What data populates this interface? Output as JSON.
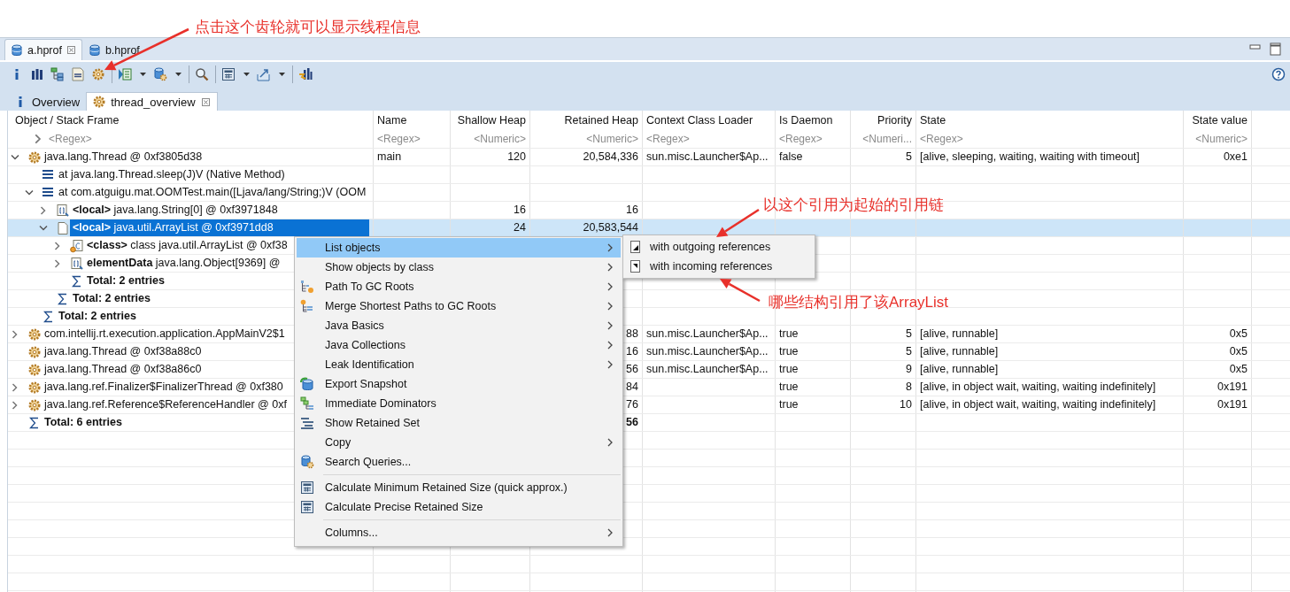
{
  "editor_tabs": [
    {
      "label": "a.hprof",
      "selected": true,
      "closable": true
    },
    {
      "label": "b.hprof",
      "selected": false,
      "closable": false
    }
  ],
  "view_tabs": [
    {
      "label": "Overview",
      "kind": "info",
      "selected": false,
      "closable": false
    },
    {
      "label": "thread_overview",
      "kind": "threads",
      "selected": true,
      "closable": true
    }
  ],
  "table": {
    "columns": [
      {
        "label": "Object / Stack Frame",
        "filter": "<Regex>"
      },
      {
        "label": "Name",
        "filter": "<Regex>"
      },
      {
        "label": "Shallow Heap",
        "filter": "<Numeric>"
      },
      {
        "label": "Retained Heap",
        "filter": "<Numeric>"
      },
      {
        "label": "Context Class Loader",
        "filter": "<Regex>"
      },
      {
        "label": "Is Daemon",
        "filter": "<Regex>"
      },
      {
        "label": "Priority",
        "filter": "<Numeri..."
      },
      {
        "label": "State",
        "filter": "<Regex>"
      },
      {
        "label": "State value",
        "filter": "<Numeric>"
      }
    ],
    "rows": [
      {
        "kind": "thread",
        "text": "java.lang.Thread @ 0xf3805d38",
        "expanded": true,
        "selected": false,
        "name": "main",
        "shallow_heap": "120",
        "retained_heap": "20,584,336",
        "class_loader": "sun.misc.Launcher$Ap...",
        "is_daemon": "false",
        "priority": "5",
        "state": "[alive, sleeping, waiting, waiting with timeout]",
        "state_value": "0xe1",
        "children": [
          {
            "kind": "frame",
            "text": "at java.lang.Thread.sleep(J)V (Native Method)",
            "selected": false
          },
          {
            "kind": "frame",
            "text": "at com.atguigu.mat.OOMTest.main([Ljava/lang/String;)V (OOM",
            "expanded": true,
            "selected": false,
            "children": [
              {
                "kind": "array",
                "text": "**<local>** java.lang.String[0] @ 0xf3971848",
                "expanded": false,
                "selected": false,
                "shallow_heap": "16",
                "retained_heap": "16"
              },
              {
                "kind": "object",
                "text": "**<local>** java.util.ArrayList @ 0xf3971dd8",
                "expanded": true,
                "selected": true,
                "shallow_heap": "24",
                "retained_heap": "20,583,544",
                "children": [
                  {
                    "kind": "class",
                    "text": "**<class>** class java.util.ArrayList @ 0xf38",
                    "expanded": false,
                    "selected": false
                  },
                  {
                    "kind": "array",
                    "text": "**elementData** java.lang.Object[9369] @",
                    "expanded": false,
                    "selected": false
                  },
                  {
                    "kind": "total",
                    "text": "Total: 2 entries",
                    "selected": false
                  }
                ]
              },
              {
                "kind": "total",
                "text": "Total: 2 entries",
                "selected": false
              }
            ]
          },
          {
            "kind": "total",
            "text": "Total: 2 entries",
            "selected": false
          }
        ]
      },
      {
        "kind": "thread",
        "text": "com.intellij.rt.execution.application.AppMainV2$1",
        "expanded": false,
        "selected": false,
        "retained_heap": "88",
        "class_loader": "sun.misc.Launcher$Ap...",
        "is_daemon": "true",
        "priority": "5",
        "state": "[alive, runnable]",
        "state_value": "0x5"
      },
      {
        "kind": "thread",
        "text": "java.lang.Thread @ 0xf38a88c0",
        "selected": false,
        "retained_heap": "16",
        "class_loader": "sun.misc.Launcher$Ap...",
        "is_daemon": "true",
        "priority": "5",
        "state": "[alive, runnable]",
        "state_value": "0x5"
      },
      {
        "kind": "thread",
        "text": "java.lang.Thread @ 0xf38a86c0",
        "selected": false,
        "retained_heap": "56",
        "class_loader": "sun.misc.Launcher$Ap...",
        "is_daemon": "true",
        "priority": "9",
        "state": "[alive, runnable]",
        "state_value": "0x5"
      },
      {
        "kind": "thread",
        "text": "java.lang.ref.Finalizer$FinalizerThread @ 0xf380",
        "expanded": false,
        "selected": false,
        "retained_heap": "84",
        "is_daemon": "true",
        "priority": "8",
        "state": "[alive, in object wait, waiting, waiting indefinitely]",
        "state_value": "0x191"
      },
      {
        "kind": "thread",
        "text": "java.lang.ref.Reference$ReferenceHandler @ 0xf",
        "expanded": false,
        "selected": false,
        "retained_heap": "76",
        "is_daemon": "true",
        "priority": "10",
        "state": "[alive, in object wait, waiting, waiting indefinitely]",
        "state_value": "0x191"
      },
      {
        "kind": "total",
        "text": "Total: 6 entries",
        "selected": false,
        "retained_heap": "56"
      }
    ]
  },
  "context_menu": {
    "items": [
      {
        "kind": "item",
        "label": "List objects",
        "submenu": true,
        "selected": true
      },
      {
        "kind": "item",
        "label": "Show objects by class",
        "submenu": true,
        "selected": false
      },
      {
        "kind": "item",
        "label": "Path To GC Roots",
        "submenu": true,
        "selected": false
      },
      {
        "kind": "item",
        "label": "Merge Shortest Paths to GC Roots",
        "submenu": true,
        "selected": false
      },
      {
        "kind": "item",
        "label": "Java Basics",
        "submenu": true,
        "selected": false
      },
      {
        "kind": "item",
        "label": "Java Collections",
        "submenu": true,
        "selected": false
      },
      {
        "kind": "item",
        "label": "Leak Identification",
        "submenu": true,
        "selected": false
      },
      {
        "kind": "item",
        "label": "Export Snapshot",
        "submenu": false,
        "selected": false
      },
      {
        "kind": "item",
        "label": "Immediate Dominators",
        "submenu": false,
        "selected": false
      },
      {
        "kind": "item",
        "label": "Show Retained Set",
        "submenu": false,
        "selected": false
      },
      {
        "kind": "item",
        "label": "Copy",
        "submenu": true,
        "selected": false
      },
      {
        "kind": "item",
        "label": "Search Queries...",
        "submenu": false,
        "selected": false
      },
      {
        "kind": "separator"
      },
      {
        "kind": "item",
        "label": "Calculate Minimum Retained Size (quick approx.)",
        "submenu": false,
        "selected": false
      },
      {
        "kind": "item",
        "label": "Calculate Precise Retained Size",
        "submenu": false,
        "selected": false
      },
      {
        "kind": "separator"
      },
      {
        "kind": "item",
        "label": "Columns...",
        "submenu": true,
        "selected": false
      }
    ],
    "submenu": [
      {
        "label": "with outgoing references",
        "kind": "outgoing",
        "selected": false
      },
      {
        "label": "with incoming references",
        "kind": "incoming",
        "selected": false
      }
    ]
  },
  "annotations": [
    {
      "text": "点击这个齿轮就可以显示线程信息"
    },
    {
      "text": "以这个引用为起始的引用链"
    },
    {
      "text": "哪些结构引用了该ArrayList"
    }
  ]
}
